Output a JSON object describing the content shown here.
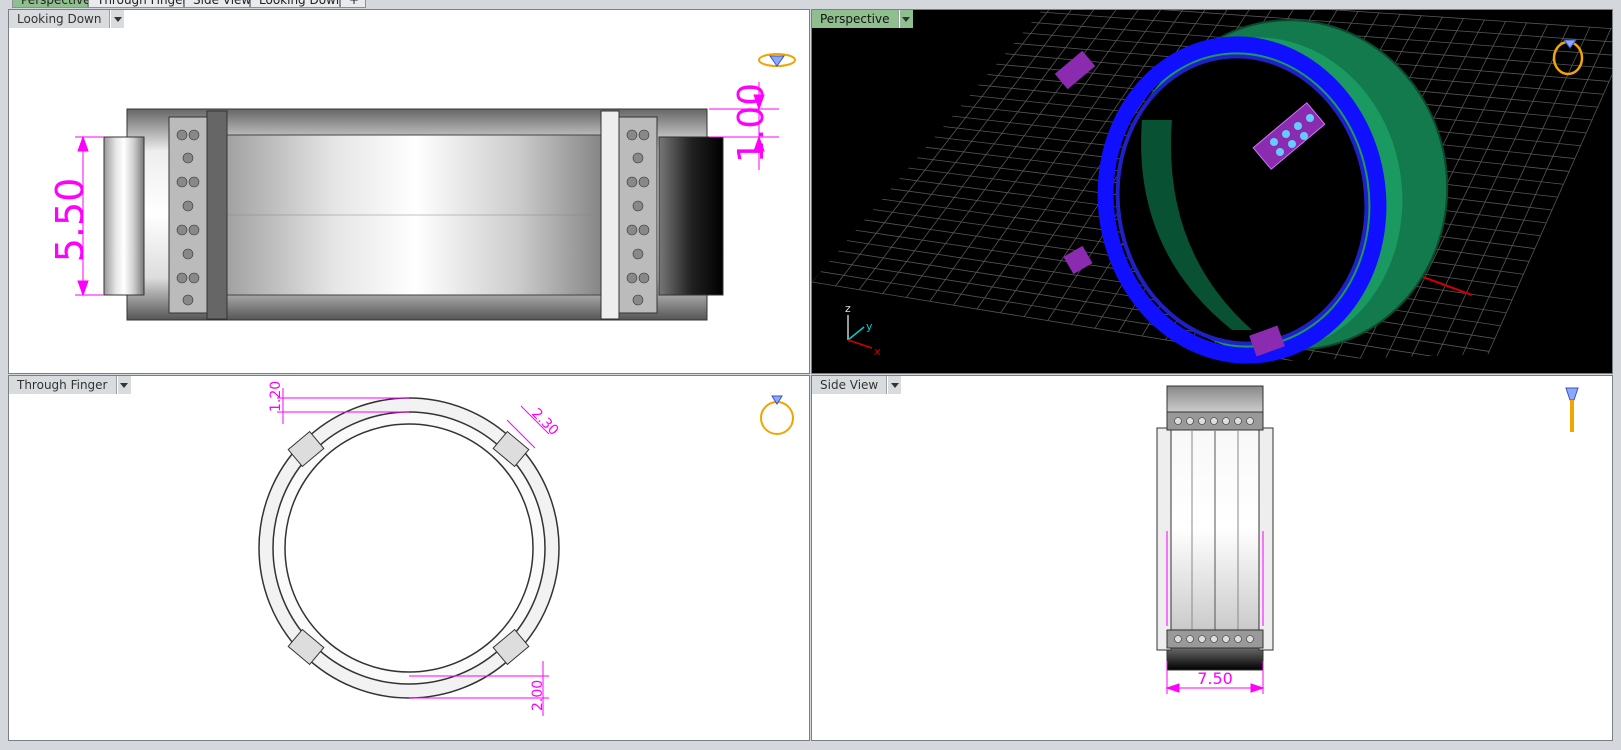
{
  "tabs": [
    {
      "label": "Perspective",
      "active": true
    },
    {
      "label": "Through Finger",
      "active": false
    },
    {
      "label": "Side View",
      "active": false
    },
    {
      "label": "Looking Down",
      "active": false
    },
    {
      "label": "+",
      "active": false
    }
  ],
  "viewports": {
    "top_left": {
      "label": "Looking Down",
      "dims": [
        "5.50",
        "1.00"
      ]
    },
    "top_right": {
      "label": "Perspective",
      "axes": [
        "z",
        "y",
        "x"
      ]
    },
    "bottom_left": {
      "label": "Through Finger",
      "dims": [
        "1.20",
        "2.30",
        "2.00"
      ]
    },
    "bottom_right": {
      "label": "Side View",
      "dims": [
        "7.50"
      ]
    }
  },
  "colors": {
    "dimension": "#ff00ff",
    "active_tab": "#8fbf8f",
    "ring_outer": "#1a8a5a",
    "ring_inner": "#1010e0",
    "settings": "#8a2bb0",
    "icon": "#f0a500"
  }
}
